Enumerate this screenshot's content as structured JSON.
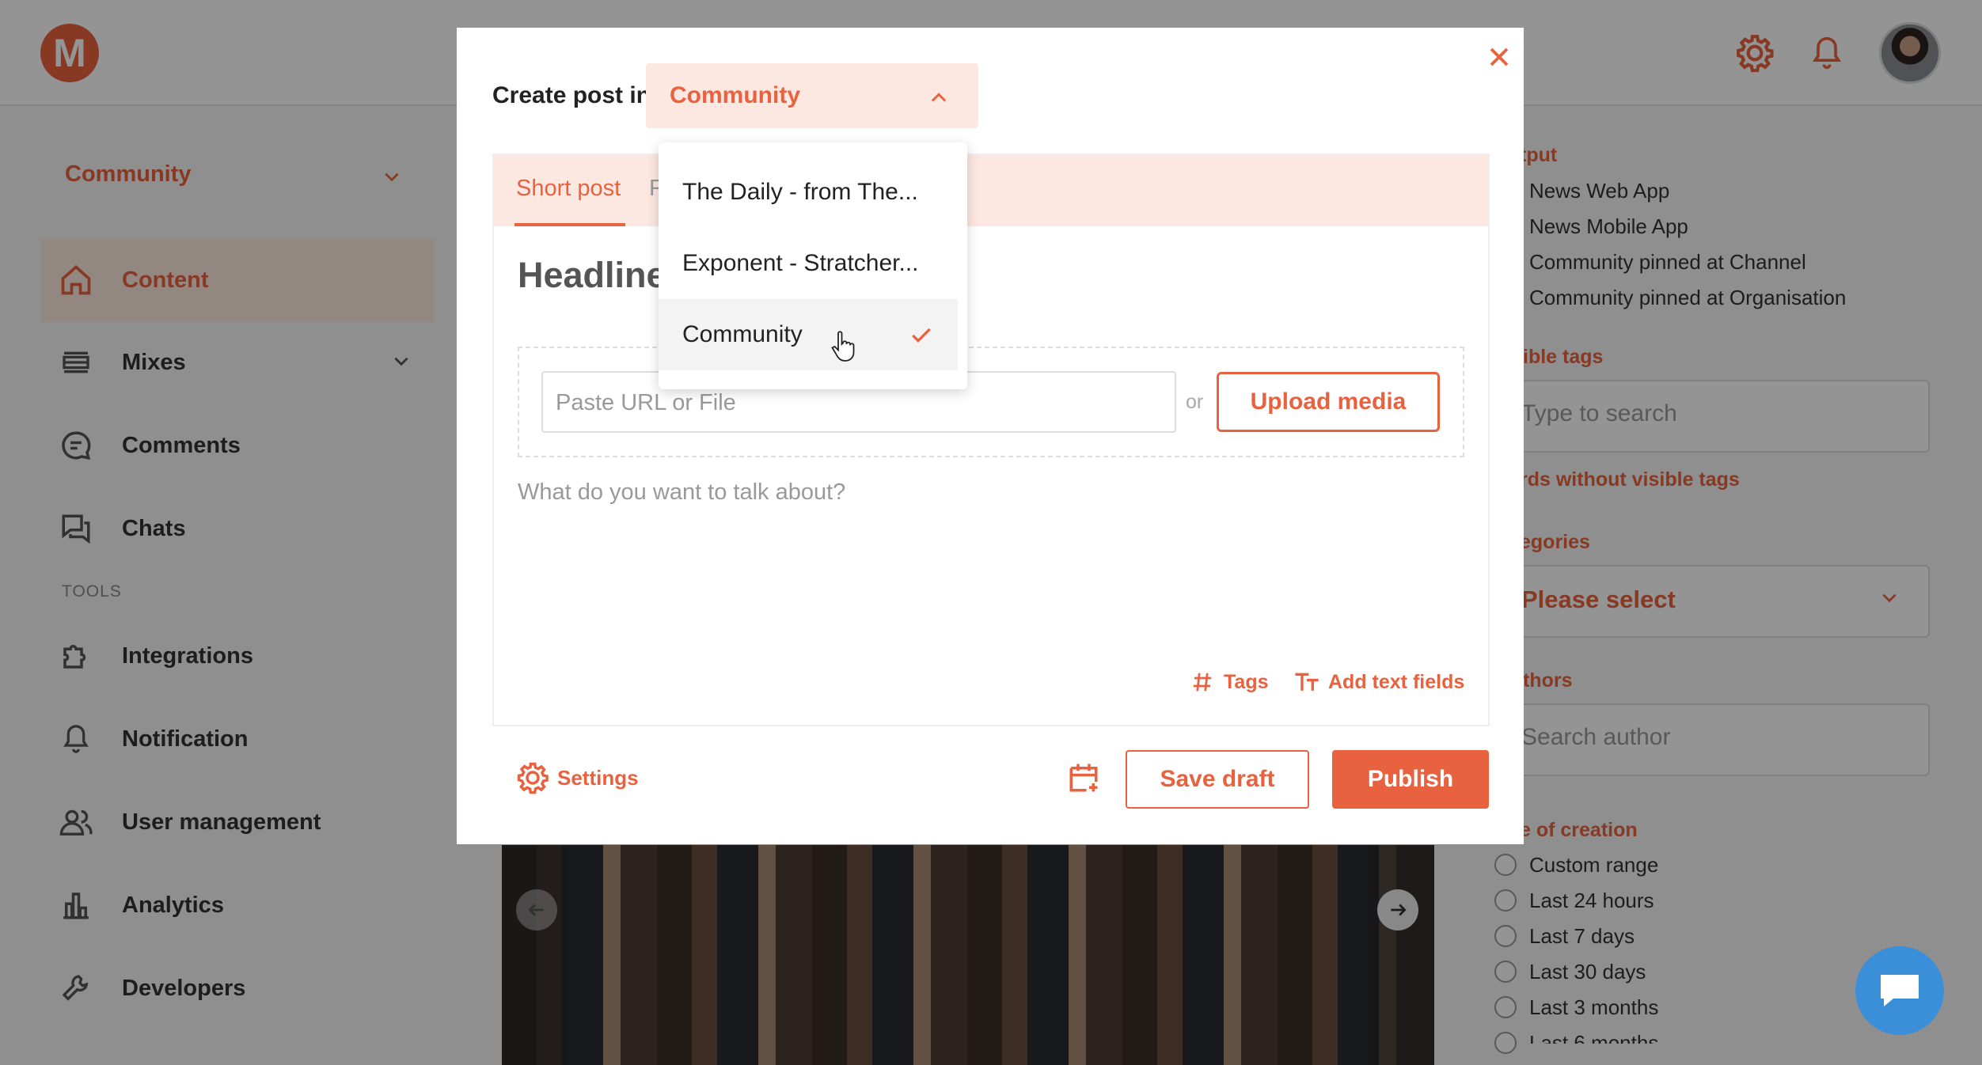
{
  "app": {
    "logo_letter": "M",
    "accent_color": "#e8623f",
    "topbar_icons": [
      "gear-icon",
      "bell-icon"
    ]
  },
  "sidebar": {
    "community_select": "Community",
    "items": [
      {
        "label": "Content",
        "icon": "home-icon",
        "active": true
      },
      {
        "label": "Mixes",
        "icon": "layers-icon",
        "has_chevron": true
      },
      {
        "label": "Comments",
        "icon": "comment-icon"
      },
      {
        "label": "Chats",
        "icon": "chats-icon"
      }
    ],
    "tools_label": "TOOLS",
    "tools": [
      {
        "label": "Integrations",
        "icon": "puzzle-icon"
      },
      {
        "label": "Notification",
        "icon": "bell-icon"
      },
      {
        "label": "User management",
        "icon": "users-icon"
      },
      {
        "label": "Analytics",
        "icon": "chart-icon"
      },
      {
        "label": "Developers",
        "icon": "wrench-icon"
      }
    ]
  },
  "right_panel": {
    "output_head": "tput",
    "outputs": [
      "News Web App",
      "News Mobile App",
      "Community pinned at Channel",
      "Community pinned at Organisation"
    ],
    "visible_tags_head": "ible tags",
    "tag_search_placeholder": "Type to search",
    "without_tags_link": "rds without visible tags",
    "categories_head": "egories",
    "categories_placeholder": "Please select",
    "authors_head": "thors",
    "author_placeholder": "Search author",
    "date_head": "e of creation",
    "date_options": [
      "Custom range",
      "Last 24 hours",
      "Last 7 days",
      "Last 30 days",
      "Last 3 months",
      "Last 6 months"
    ]
  },
  "modal": {
    "create_label": "Create post in",
    "selected_channel": "Community",
    "tabs": [
      {
        "label": "Short post",
        "active": true
      },
      {
        "label": "F",
        "active": false
      }
    ],
    "headline_placeholder": "Headline",
    "url_placeholder": "Paste URL or File",
    "or_label": "or",
    "upload_label": "Upload media",
    "body_placeholder": "What do you want to talk about?",
    "tags_label": "Tags",
    "add_text_fields_label": "Add text fields",
    "settings_label": "Settings",
    "save_draft_label": "Save draft",
    "publish_label": "Publish"
  },
  "dropdown": {
    "options": [
      {
        "label": "The Daily - from The...",
        "selected": false
      },
      {
        "label": "Exponent - Stratcher...",
        "selected": false
      },
      {
        "label": "Community",
        "selected": true
      }
    ]
  }
}
